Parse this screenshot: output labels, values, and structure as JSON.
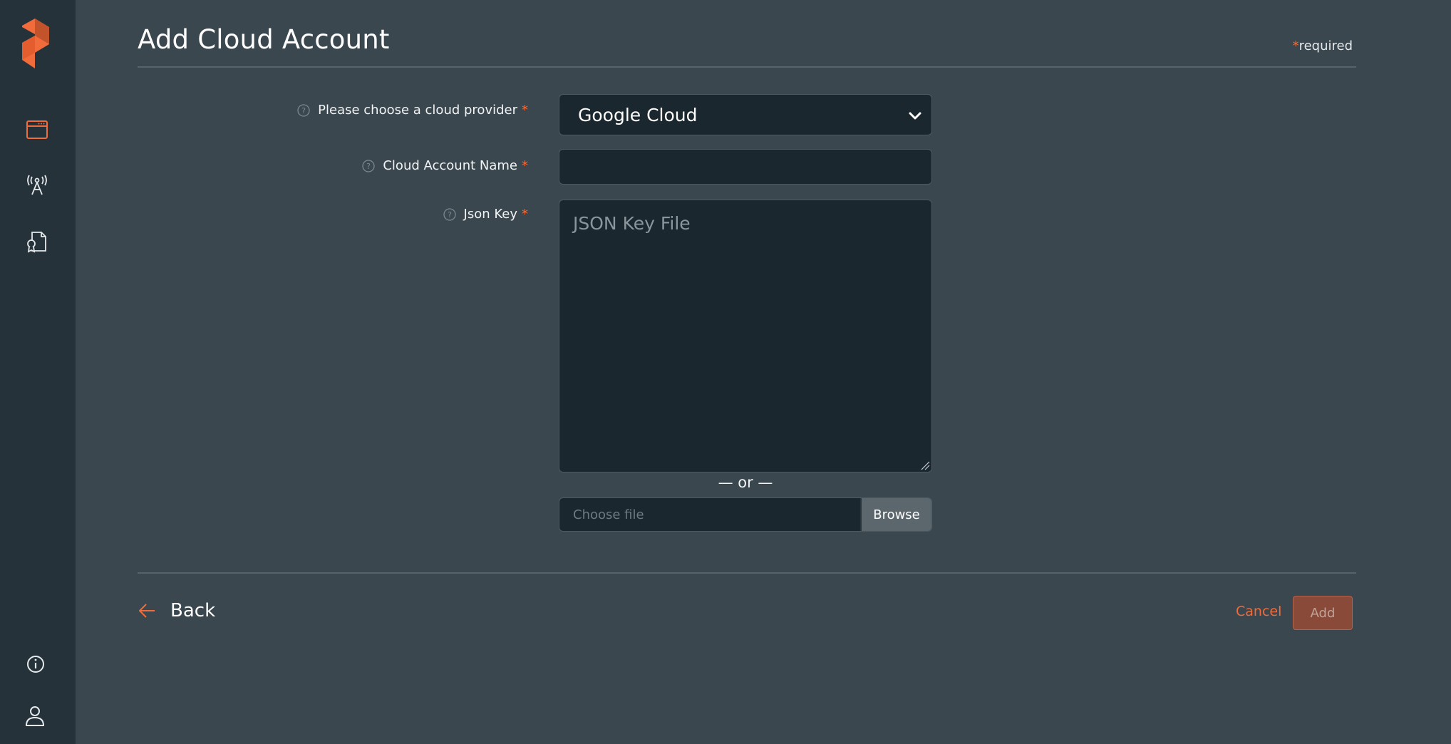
{
  "header": {
    "title": "Add Cloud Account",
    "required_star": "*",
    "required_text": "required"
  },
  "sidebar": {
    "logo": "platform-logo",
    "items": [
      {
        "icon": "window-icon"
      },
      {
        "icon": "antenna-icon"
      },
      {
        "icon": "certificate-icon"
      }
    ],
    "bottom_items": [
      {
        "icon": "info-icon"
      },
      {
        "icon": "user-icon"
      }
    ]
  },
  "form": {
    "provider": {
      "label": "Please choose a cloud provider",
      "required_mark": "*",
      "value": "Google Cloud"
    },
    "account_name": {
      "label": "Cloud Account Name",
      "required_mark": "*",
      "value": ""
    },
    "json_key": {
      "label": "Json Key",
      "required_mark": "*",
      "placeholder": "JSON Key File"
    },
    "or_text": "— or —",
    "file": {
      "placeholder": "Choose file",
      "browse_label": "Browse"
    }
  },
  "footer": {
    "back_label": "Back",
    "cancel_label": "Cancel",
    "add_label": "Add"
  },
  "colors": {
    "accent": "#f26b3a",
    "background": "#3a474f",
    "sidebar": "#25323a",
    "input": "#1b272e"
  }
}
